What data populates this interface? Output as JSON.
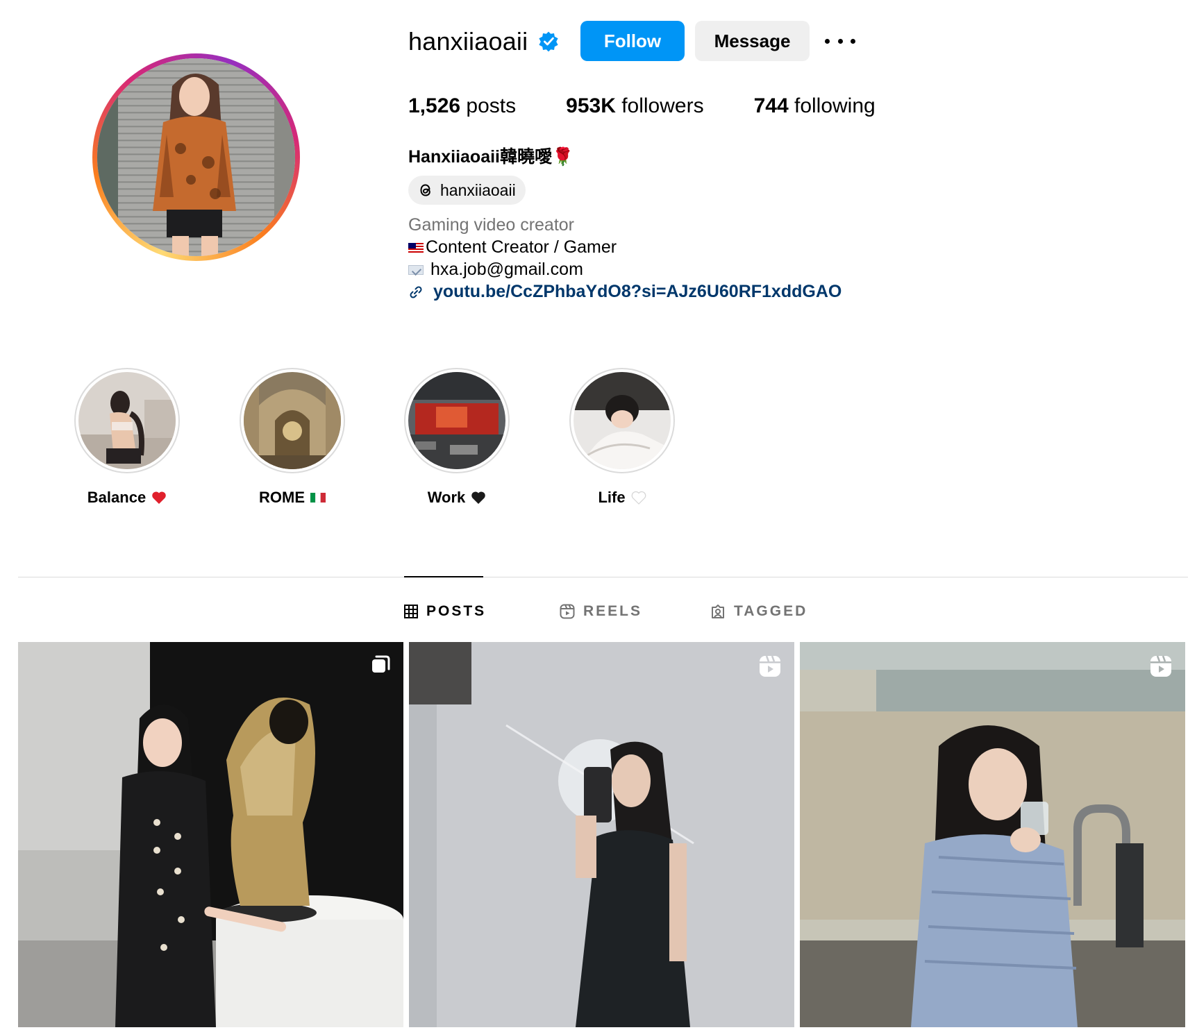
{
  "profile": {
    "username": "hanxiiaoaii",
    "verified": true,
    "follow_label": "Follow",
    "message_label": "Message",
    "stats": {
      "posts_count": "1,526",
      "posts_label": "posts",
      "followers_count": "953K",
      "followers_label": "followers",
      "following_count": "744",
      "following_label": "following"
    },
    "full_name": "Hanxiiaoaii韓曉噯🌹",
    "threads_handle": "hanxiiaoaii",
    "category": "Gaming video creator",
    "bio_line1": "Content Creator / Gamer",
    "bio_line2": "hxa.job@gmail.com",
    "link": "youtu.be/CcZPhbaYdO8?si=AJz6U60RF1xddGAO"
  },
  "highlights": [
    {
      "label": "Balance",
      "emoji": "red-heart"
    },
    {
      "label": "ROME",
      "emoji": "italy-flag"
    },
    {
      "label": "Work",
      "emoji": "black-heart"
    },
    {
      "label": "Life",
      "emoji": "white-heart"
    }
  ],
  "tabs": [
    {
      "label": "POSTS",
      "icon": "grid-icon",
      "active": true
    },
    {
      "label": "REELS",
      "icon": "reels-icon",
      "active": false
    },
    {
      "label": "TAGGED",
      "icon": "tagged-icon",
      "active": false
    }
  ],
  "posts": [
    {
      "type": "carousel",
      "badge_icon": "carousel-icon"
    },
    {
      "type": "reel",
      "badge_icon": "reels-icon"
    },
    {
      "type": "reel",
      "badge_icon": "reels-icon"
    }
  ],
  "colors": {
    "accent": "#0095f6",
    "link": "#00376b",
    "muted": "#737373",
    "button_secondary": "#efefef"
  }
}
